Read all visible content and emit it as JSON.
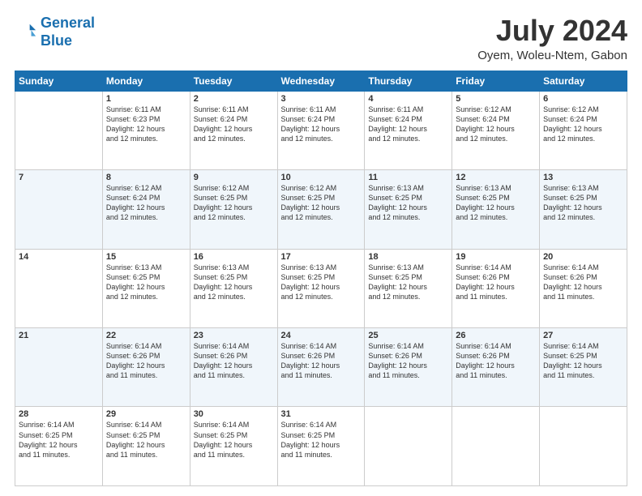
{
  "header": {
    "logo_line1": "General",
    "logo_line2": "Blue",
    "title": "July 2024",
    "subtitle": "Oyem, Woleu-Ntem, Gabon"
  },
  "days_of_week": [
    "Sunday",
    "Monday",
    "Tuesday",
    "Wednesday",
    "Thursday",
    "Friday",
    "Saturday"
  ],
  "weeks": [
    [
      {
        "day": "",
        "info": ""
      },
      {
        "day": "1",
        "info": "Sunrise: 6:11 AM\nSunset: 6:23 PM\nDaylight: 12 hours\nand 12 minutes."
      },
      {
        "day": "2",
        "info": "Sunrise: 6:11 AM\nSunset: 6:24 PM\nDaylight: 12 hours\nand 12 minutes."
      },
      {
        "day": "3",
        "info": "Sunrise: 6:11 AM\nSunset: 6:24 PM\nDaylight: 12 hours\nand 12 minutes."
      },
      {
        "day": "4",
        "info": "Sunrise: 6:11 AM\nSunset: 6:24 PM\nDaylight: 12 hours\nand 12 minutes."
      },
      {
        "day": "5",
        "info": "Sunrise: 6:12 AM\nSunset: 6:24 PM\nDaylight: 12 hours\nand 12 minutes."
      },
      {
        "day": "6",
        "info": "Sunrise: 6:12 AM\nSunset: 6:24 PM\nDaylight: 12 hours\nand 12 minutes."
      }
    ],
    [
      {
        "day": "7",
        "info": ""
      },
      {
        "day": "8",
        "info": "Sunrise: 6:12 AM\nSunset: 6:24 PM\nDaylight: 12 hours\nand 12 minutes."
      },
      {
        "day": "9",
        "info": "Sunrise: 6:12 AM\nSunset: 6:25 PM\nDaylight: 12 hours\nand 12 minutes."
      },
      {
        "day": "10",
        "info": "Sunrise: 6:12 AM\nSunset: 6:25 PM\nDaylight: 12 hours\nand 12 minutes."
      },
      {
        "day": "11",
        "info": "Sunrise: 6:13 AM\nSunset: 6:25 PM\nDaylight: 12 hours\nand 12 minutes."
      },
      {
        "day": "12",
        "info": "Sunrise: 6:13 AM\nSunset: 6:25 PM\nDaylight: 12 hours\nand 12 minutes."
      },
      {
        "day": "13",
        "info": "Sunrise: 6:13 AM\nSunset: 6:25 PM\nDaylight: 12 hours\nand 12 minutes."
      }
    ],
    [
      {
        "day": "14",
        "info": ""
      },
      {
        "day": "15",
        "info": "Sunrise: 6:13 AM\nSunset: 6:25 PM\nDaylight: 12 hours\nand 12 minutes."
      },
      {
        "day": "16",
        "info": "Sunrise: 6:13 AM\nSunset: 6:25 PM\nDaylight: 12 hours\nand 12 minutes."
      },
      {
        "day": "17",
        "info": "Sunrise: 6:13 AM\nSunset: 6:25 PM\nDaylight: 12 hours\nand 12 minutes."
      },
      {
        "day": "18",
        "info": "Sunrise: 6:13 AM\nSunset: 6:25 PM\nDaylight: 12 hours\nand 12 minutes."
      },
      {
        "day": "19",
        "info": "Sunrise: 6:14 AM\nSunset: 6:26 PM\nDaylight: 12 hours\nand 11 minutes."
      },
      {
        "day": "20",
        "info": "Sunrise: 6:14 AM\nSunset: 6:26 PM\nDaylight: 12 hours\nand 11 minutes."
      }
    ],
    [
      {
        "day": "21",
        "info": ""
      },
      {
        "day": "22",
        "info": "Sunrise: 6:14 AM\nSunset: 6:26 PM\nDaylight: 12 hours\nand 11 minutes."
      },
      {
        "day": "23",
        "info": "Sunrise: 6:14 AM\nSunset: 6:26 PM\nDaylight: 12 hours\nand 11 minutes."
      },
      {
        "day": "24",
        "info": "Sunrise: 6:14 AM\nSunset: 6:26 PM\nDaylight: 12 hours\nand 11 minutes."
      },
      {
        "day": "25",
        "info": "Sunrise: 6:14 AM\nSunset: 6:26 PM\nDaylight: 12 hours\nand 11 minutes."
      },
      {
        "day": "26",
        "info": "Sunrise: 6:14 AM\nSunset: 6:26 PM\nDaylight: 12 hours\nand 11 minutes."
      },
      {
        "day": "27",
        "info": "Sunrise: 6:14 AM\nSunset: 6:25 PM\nDaylight: 12 hours\nand 11 minutes."
      }
    ],
    [
      {
        "day": "28",
        "info": "Sunrise: 6:14 AM\nSunset: 6:25 PM\nDaylight: 12 hours\nand 11 minutes."
      },
      {
        "day": "29",
        "info": "Sunrise: 6:14 AM\nSunset: 6:25 PM\nDaylight: 12 hours\nand 11 minutes."
      },
      {
        "day": "30",
        "info": "Sunrise: 6:14 AM\nSunset: 6:25 PM\nDaylight: 12 hours\nand 11 minutes."
      },
      {
        "day": "31",
        "info": "Sunrise: 6:14 AM\nSunset: 6:25 PM\nDaylight: 12 hours\nand 11 minutes."
      },
      {
        "day": "",
        "info": ""
      },
      {
        "day": "",
        "info": ""
      },
      {
        "day": "",
        "info": ""
      }
    ]
  ]
}
